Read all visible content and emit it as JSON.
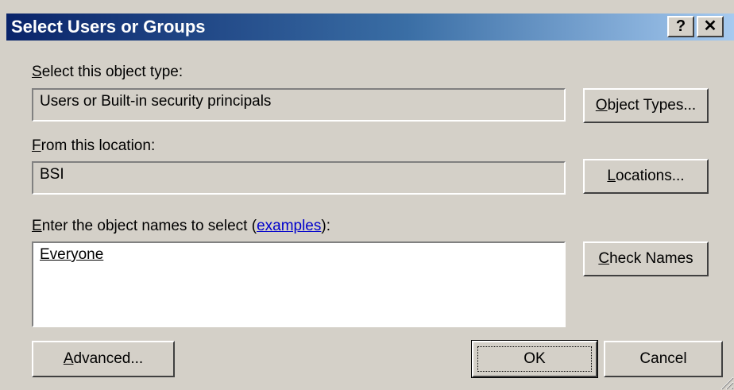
{
  "window": {
    "title": "Select Users or Groups",
    "help_label": "?",
    "close_label": "✕"
  },
  "object_type": {
    "label_prefix": "",
    "label_accel": "S",
    "label_rest": "elect this object type:",
    "value": "Users or Built-in security principals",
    "button_accel": "O",
    "button_rest": "bject Types..."
  },
  "location": {
    "label_accel": "F",
    "label_rest": "rom this location:",
    "value": "BSI",
    "button_accel": "L",
    "button_rest": "ocations..."
  },
  "names": {
    "label_accel": "E",
    "label_rest": "nter the object names to select (",
    "link_text": "examples",
    "label_tail": "):",
    "value": "Everyone",
    "check_accel": "C",
    "check_rest": "heck Names"
  },
  "footer": {
    "advanced_accel": "A",
    "advanced_rest": "dvanced...",
    "ok_label": "OK",
    "cancel_label": "Cancel"
  }
}
